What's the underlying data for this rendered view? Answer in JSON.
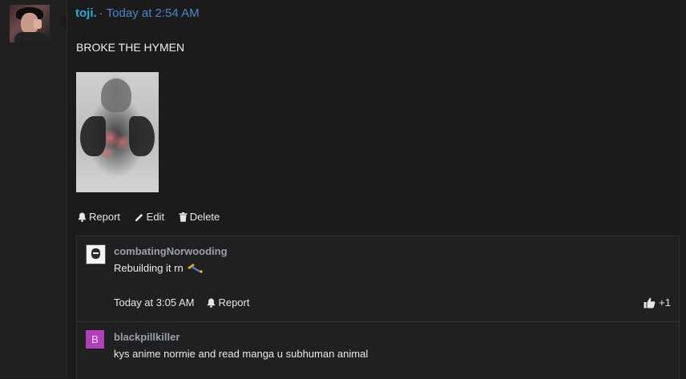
{
  "post": {
    "username": "toji.",
    "separator": "·",
    "timestamp": "Today at 2:54 AM",
    "text": "BROKE THE HYMEN",
    "actions": {
      "report": "Report",
      "edit": "Edit",
      "delete": "Delete"
    }
  },
  "comments": [
    {
      "username": "combatingNorwooding",
      "text": "Rebuilding it rn",
      "emoji": "hammer-icon",
      "timestamp": "Today at 3:05 AM",
      "report": "Report",
      "likes": "+1"
    },
    {
      "username": "blackpillkiller",
      "avatar_letter": "B",
      "avatar_color": "#b13fb8",
      "text": "kys anime normie and read manga u subhuman animal"
    }
  ],
  "colors": {
    "background": "#1b1b1b",
    "username": "#2ea8d9",
    "timestamp": "#4e84c9",
    "comment_username": "#9aa0a8"
  }
}
